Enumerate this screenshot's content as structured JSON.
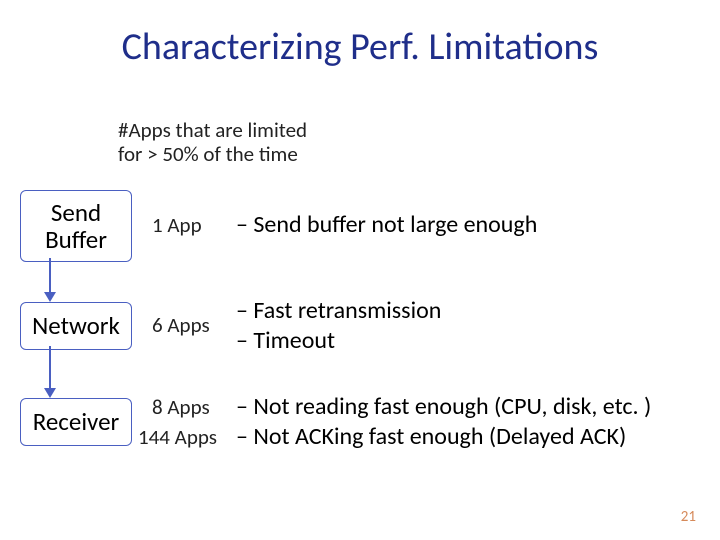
{
  "title": "Characterizing Perf. Limitations",
  "header_note_line1": "#Apps that are limited",
  "header_note_line2": "for > 50% of the time",
  "flow": {
    "send_buffer": {
      "label_line1": "Send",
      "label_line2": "Buffer"
    },
    "network": {
      "label": "Network"
    },
    "receiver": {
      "label": "Receiver"
    }
  },
  "rows": {
    "send_buffer": {
      "count": "1 App",
      "desc": "– Send buffer not large enough"
    },
    "network": {
      "count": "6 Apps",
      "desc_line1": "– Fast retransmission",
      "desc_line2": "– Timeout"
    },
    "receiver_a": {
      "count": "8 Apps",
      "desc": "– Not reading fast enough (CPU, disk, etc. )"
    },
    "receiver_b": {
      "count": "144 Apps",
      "desc": "– Not ACKing fast enough (Delayed ACK)"
    }
  },
  "page_number": "21"
}
